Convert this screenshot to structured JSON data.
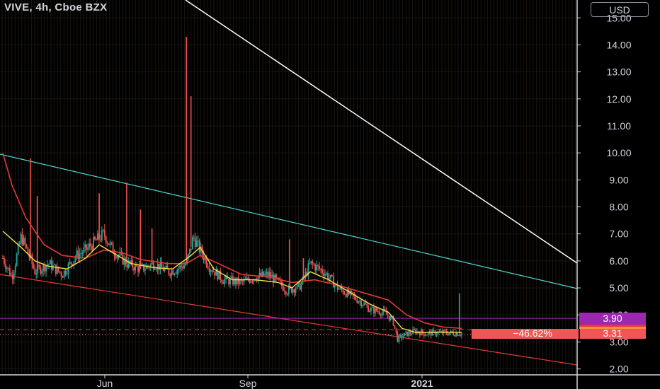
{
  "header": {
    "title": "VIVE, 4h, Cboe BZX",
    "currency": "USD"
  },
  "chart_data": {
    "type": "candlestick",
    "title": "VIVE, 4h, Cboe BZX",
    "currency": "USD",
    "ylim": [
      1.8,
      16.3
    ],
    "y_ticks": [
      "2.00",
      "3.00",
      "4.00",
      "5.00",
      "6.00",
      "7.00",
      "8.00",
      "9.00",
      "10.00",
      "11.00",
      "12.00",
      "13.00",
      "14.00",
      "15.00"
    ],
    "x_ticks": [
      "Jun",
      "Sep",
      "2021"
    ],
    "last_price_label": "3.31",
    "change_label": "−46.62%",
    "level_label": "3.90",
    "price_path": [
      [
        0,
        6.1
      ],
      [
        0.02,
        5.4
      ],
      [
        0.04,
        6.9
      ],
      [
        0.055,
        6.3
      ],
      [
        0.07,
        5.6
      ],
      [
        0.1,
        5.9
      ],
      [
        0.13,
        5.5
      ],
      [
        0.16,
        6.2
      ],
      [
        0.18,
        6.4
      ],
      [
        0.2,
        6.7
      ],
      [
        0.22,
        7.0
      ],
      [
        0.24,
        6.4
      ],
      [
        0.27,
        5.9
      ],
      [
        0.3,
        5.7
      ],
      [
        0.33,
        5.9
      ],
      [
        0.36,
        5.6
      ],
      [
        0.38,
        5.7
      ],
      [
        0.4,
        5.9
      ],
      [
        0.41,
        6.5
      ],
      [
        0.415,
        6.9
      ],
      [
        0.43,
        6.4
      ],
      [
        0.45,
        5.8
      ],
      [
        0.48,
        5.3
      ],
      [
        0.52,
        5.2
      ],
      [
        0.55,
        5.4
      ],
      [
        0.58,
        5.5
      ],
      [
        0.62,
        4.9
      ],
      [
        0.65,
        5.1
      ],
      [
        0.67,
        5.9
      ],
      [
        0.7,
        5.6
      ],
      [
        0.73,
        5.0
      ],
      [
        0.76,
        4.7
      ],
      [
        0.78,
        4.5
      ],
      [
        0.8,
        4.2
      ],
      [
        0.83,
        4.1
      ],
      [
        0.85,
        3.8
      ],
      [
        0.86,
        3.1
      ],
      [
        0.88,
        3.3
      ],
      [
        0.9,
        3.4
      ],
      [
        0.92,
        3.3
      ],
      [
        0.95,
        3.35
      ],
      [
        1.0,
        3.31
      ]
    ],
    "spikes": [
      [
        0.06,
        9.8
      ],
      [
        0.075,
        8.4
      ],
      [
        0.21,
        8.5
      ],
      [
        0.27,
        8.9
      ],
      [
        0.3,
        7.9
      ],
      [
        0.325,
        7.2
      ],
      [
        0.4,
        14.3
      ],
      [
        0.41,
        12.1
      ],
      [
        0.625,
        6.8
      ],
      [
        0.655,
        6.1
      ],
      [
        0.995,
        4.8
      ]
    ],
    "moving_average_fast": [
      [
        0,
        7.1
      ],
      [
        0.04,
        6.5
      ],
      [
        0.07,
        6.0
      ],
      [
        0.1,
        5.8
      ],
      [
        0.14,
        5.7
      ],
      [
        0.18,
        6.1
      ],
      [
        0.21,
        6.6
      ],
      [
        0.24,
        6.3
      ],
      [
        0.28,
        5.9
      ],
      [
        0.33,
        5.75
      ],
      [
        0.37,
        5.7
      ],
      [
        0.41,
        6.2
      ],
      [
        0.43,
        6.5
      ],
      [
        0.46,
        5.7
      ],
      [
        0.5,
        5.3
      ],
      [
        0.55,
        5.3
      ],
      [
        0.6,
        5.2
      ],
      [
        0.63,
        5.0
      ],
      [
        0.67,
        5.6
      ],
      [
        0.71,
        5.3
      ],
      [
        0.75,
        4.9
      ],
      [
        0.8,
        4.4
      ],
      [
        0.84,
        4.1
      ],
      [
        0.87,
        3.5
      ],
      [
        0.9,
        3.35
      ],
      [
        0.95,
        3.36
      ],
      [
        1.0,
        3.35
      ]
    ],
    "moving_average_slow": [
      [
        0,
        10.0
      ],
      [
        0.02,
        8.8
      ],
      [
        0.05,
        7.6
      ],
      [
        0.09,
        6.6
      ],
      [
        0.13,
        6.2
      ],
      [
        0.18,
        6.1
      ],
      [
        0.22,
        6.4
      ],
      [
        0.26,
        6.3
      ],
      [
        0.3,
        6.05
      ],
      [
        0.36,
        5.9
      ],
      [
        0.4,
        5.9
      ],
      [
        0.43,
        6.2
      ],
      [
        0.47,
        5.9
      ],
      [
        0.52,
        5.5
      ],
      [
        0.58,
        5.4
      ],
      [
        0.63,
        5.2
      ],
      [
        0.68,
        5.3
      ],
      [
        0.73,
        5.1
      ],
      [
        0.79,
        4.8
      ],
      [
        0.84,
        4.55
      ],
      [
        0.88,
        4.0
      ],
      [
        0.92,
        3.7
      ],
      [
        0.96,
        3.55
      ],
      [
        1.0,
        3.5
      ]
    ]
  }
}
